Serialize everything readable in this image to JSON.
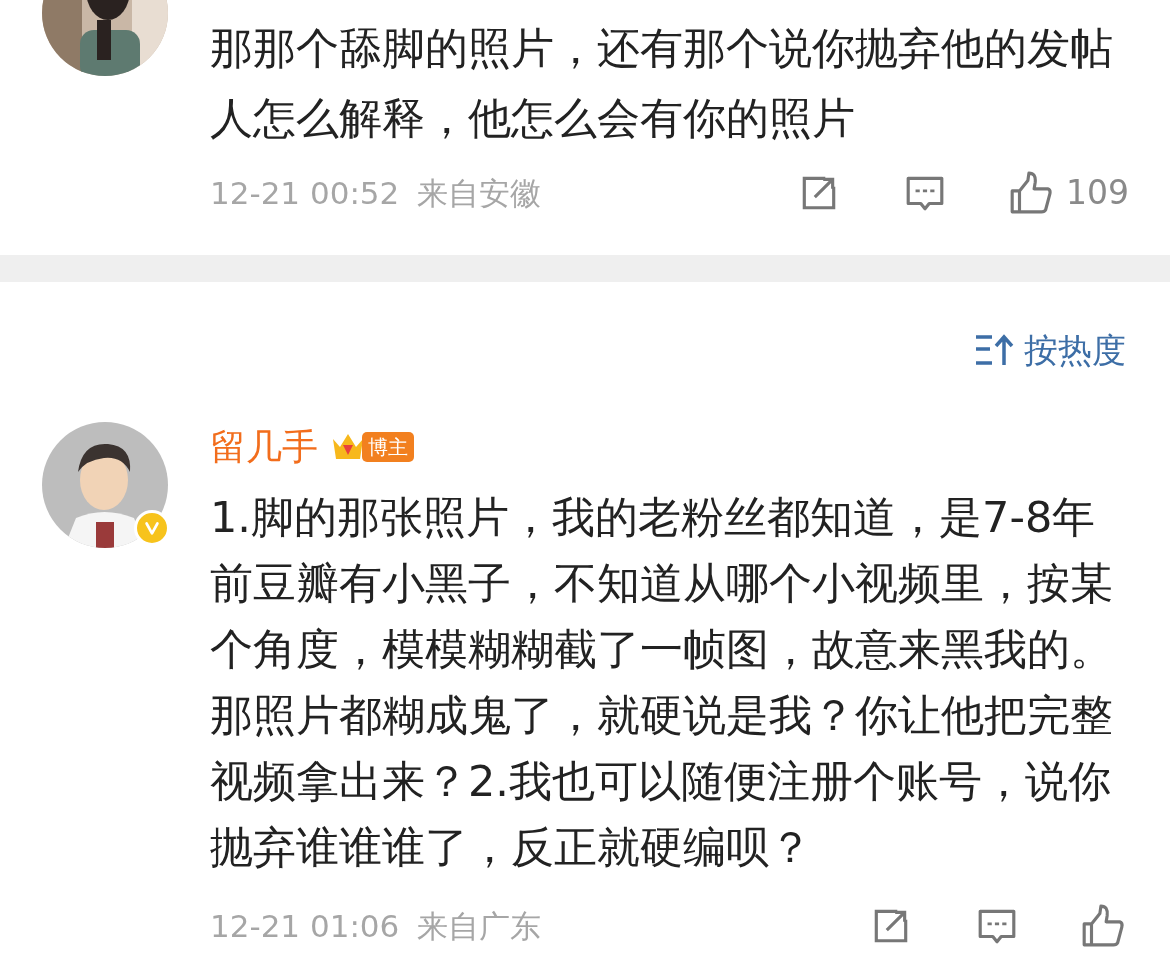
{
  "comments": [
    {
      "avatar": {
        "verified": false
      },
      "text": "那那个舔脚的照片，还有那个说你抛弃他的发帖人怎么解释，他怎么会有你的照片",
      "time": "12-21 00:52",
      "location": "来自安徽",
      "likes": "109"
    },
    {
      "avatar": {
        "verified": true
      },
      "user": "留几手",
      "badge": "博主",
      "text": "1.脚的那张照片，我的老粉丝都知道，是7-8年前豆瓣有小黑子，不知道从哪个小视频里，按某个角度，模模糊糊截了一帧图，故意来黑我的。那照片都糊成鬼了，就硬说是我？你让他把完整视频拿出来？2.我也可以随便注册个账号，说你抛弃谁谁谁了，反正就硬编呗？",
      "time": "12-21 01:06",
      "location": "来自广东"
    }
  ],
  "sort": {
    "label": "按热度"
  }
}
